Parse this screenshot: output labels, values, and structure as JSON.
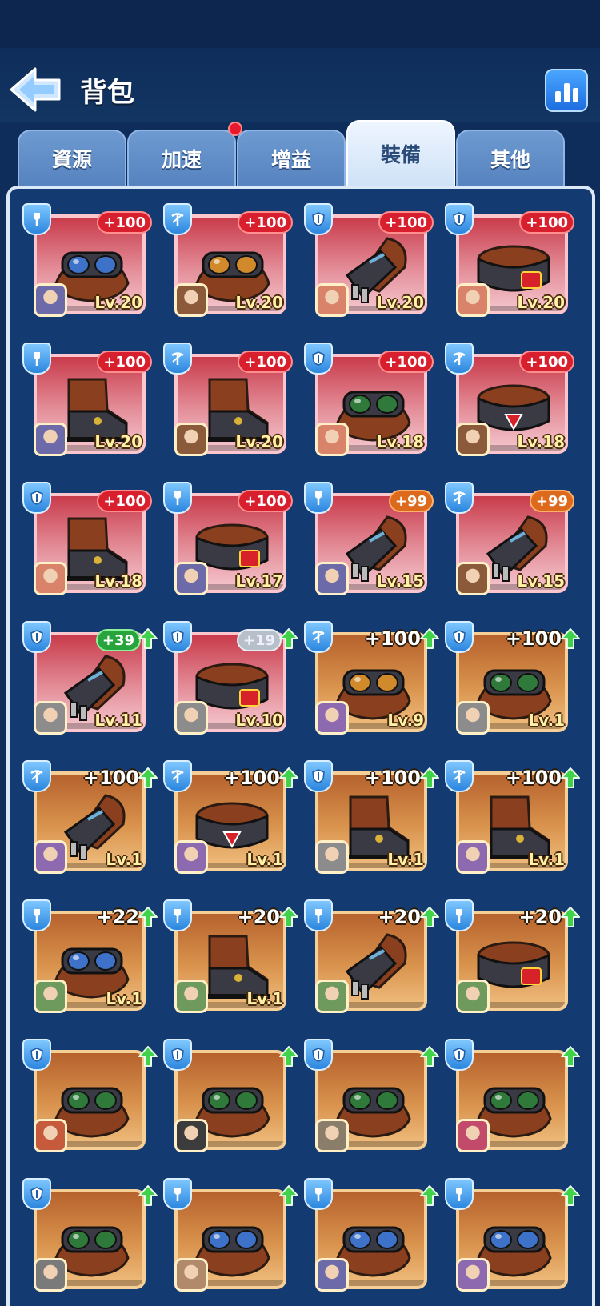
{
  "header": {
    "title": "背包"
  },
  "tabs": [
    {
      "label": "資源",
      "active": false,
      "dot": false
    },
    {
      "label": "加速",
      "active": false,
      "dot": true
    },
    {
      "label": "增益",
      "active": false,
      "dot": false
    },
    {
      "label": "裝備",
      "active": true,
      "dot": false
    },
    {
      "label": "其他",
      "active": false,
      "dot": false
    }
  ],
  "colors": {
    "accent": "#2c86de",
    "red_card": "#c93b4b",
    "orange_card": "#d9934d",
    "badge_red": "#d81f2e",
    "badge_green": "#27a53c"
  },
  "items": [
    {
      "cls": "shovel",
      "gear": "goggles-blue",
      "bonus": "+100",
      "style": "red",
      "arrow": false,
      "level": "Lv.20",
      "hero": "#6c6aa8",
      "bg": "red"
    },
    {
      "cls": "crossbow",
      "gear": "goggles-orange",
      "bonus": "+100",
      "style": "red",
      "arrow": false,
      "level": "Lv.20",
      "hero": "#8a5a3a",
      "bg": "red"
    },
    {
      "cls": "shield",
      "gear": "gauntlet",
      "bonus": "+100",
      "style": "red",
      "arrow": false,
      "level": "Lv.20",
      "hero": "#d9846a",
      "bg": "red"
    },
    {
      "cls": "shield",
      "gear": "bracer-red",
      "bonus": "+100",
      "style": "red",
      "arrow": false,
      "level": "Lv.20",
      "hero": "#d9846a",
      "bg": "red"
    },
    {
      "cls": "shovel",
      "gear": "boot",
      "bonus": "+100",
      "style": "red",
      "arrow": false,
      "level": "Lv.20",
      "hero": "#6c6aa8",
      "bg": "red"
    },
    {
      "cls": "crossbow",
      "gear": "boot",
      "bonus": "+100",
      "style": "red",
      "arrow": false,
      "level": "Lv.20",
      "hero": "#8a5a3a",
      "bg": "red"
    },
    {
      "cls": "shield",
      "gear": "goggles-green",
      "bonus": "+100",
      "style": "red",
      "arrow": false,
      "level": "Lv.18",
      "hero": "#d9846a",
      "bg": "red"
    },
    {
      "cls": "crossbow",
      "gear": "bracer-tri",
      "bonus": "+100",
      "style": "red",
      "arrow": false,
      "level": "Lv.18",
      "hero": "#8a5a3a",
      "bg": "red"
    },
    {
      "cls": "shield",
      "gear": "boot",
      "bonus": "+100",
      "style": "red",
      "arrow": false,
      "level": "Lv.18",
      "hero": "#d9846a",
      "bg": "red"
    },
    {
      "cls": "shovel",
      "gear": "bracer-red",
      "bonus": "+100",
      "style": "red",
      "arrow": false,
      "level": "Lv.17",
      "hero": "#6c6aa8",
      "bg": "red"
    },
    {
      "cls": "shovel",
      "gear": "gauntlet",
      "bonus": "+99",
      "style": "orange",
      "arrow": false,
      "level": "Lv.15",
      "hero": "#6c6aa8",
      "bg": "red"
    },
    {
      "cls": "crossbow",
      "gear": "gauntlet",
      "bonus": "+99",
      "style": "orange",
      "arrow": false,
      "level": "Lv.15",
      "hero": "#8a5a3a",
      "bg": "red"
    },
    {
      "cls": "shield",
      "gear": "gauntlet",
      "bonus": "+39",
      "style": "green",
      "arrow": true,
      "level": "Lv.11",
      "hero": "#8c8c8c",
      "bg": "red"
    },
    {
      "cls": "shield",
      "gear": "bracer-red",
      "bonus": "+19",
      "style": "silver",
      "arrow": true,
      "level": "Lv.10",
      "hero": "#8c8c8c",
      "bg": "red"
    },
    {
      "cls": "crossbow",
      "gear": "goggles-orange",
      "bonus": "+100",
      "style": "plain",
      "arrow": true,
      "level": "Lv.9",
      "hero": "#8d6ab0",
      "bg": "orange"
    },
    {
      "cls": "shield",
      "gear": "goggles-green",
      "bonus": "+100",
      "style": "plain",
      "arrow": true,
      "level": "Lv.1",
      "hero": "#8c8c8c",
      "bg": "orange"
    },
    {
      "cls": "crossbow",
      "gear": "gauntlet",
      "bonus": "+100",
      "style": "plain",
      "arrow": true,
      "level": "Lv.1",
      "hero": "#8d6ab0",
      "bg": "orange"
    },
    {
      "cls": "crossbow",
      "gear": "bracer-tri",
      "bonus": "+100",
      "style": "plain",
      "arrow": true,
      "level": "Lv.1",
      "hero": "#8d6ab0",
      "bg": "orange"
    },
    {
      "cls": "shield",
      "gear": "boot",
      "bonus": "+100",
      "style": "plain",
      "arrow": true,
      "level": "Lv.1",
      "hero": "#8c8c8c",
      "bg": "orange"
    },
    {
      "cls": "crossbow",
      "gear": "boot",
      "bonus": "+100",
      "style": "plain",
      "arrow": true,
      "level": "Lv.1",
      "hero": "#8d6ab0",
      "bg": "orange"
    },
    {
      "cls": "shovel",
      "gear": "goggles-blue",
      "bonus": "+22",
      "style": "plain",
      "arrow": true,
      "level": "Lv.1",
      "hero": "#6e9a5e",
      "bg": "orange"
    },
    {
      "cls": "shovel",
      "gear": "boot",
      "bonus": "+20",
      "style": "plain",
      "arrow": true,
      "level": "Lv.1",
      "hero": "#6e9a5e",
      "bg": "orange"
    },
    {
      "cls": "shovel",
      "gear": "gauntlet",
      "bonus": "+20",
      "style": "plain",
      "arrow": true,
      "level": "",
      "hero": "#6e9a5e",
      "bg": "orange"
    },
    {
      "cls": "shovel",
      "gear": "bracer-red",
      "bonus": "+20",
      "style": "plain",
      "arrow": true,
      "level": "",
      "hero": "#6e9a5e",
      "bg": "orange"
    },
    {
      "cls": "shield",
      "gear": "goggles-green",
      "bonus": "",
      "style": "none",
      "arrow": true,
      "level": "",
      "hero": "#c65a3c",
      "bg": "orange"
    },
    {
      "cls": "shield",
      "gear": "goggles-green",
      "bonus": "",
      "style": "none",
      "arrow": true,
      "level": "",
      "hero": "#3c3c3c",
      "bg": "orange"
    },
    {
      "cls": "shield",
      "gear": "goggles-green",
      "bonus": "",
      "style": "none",
      "arrow": true,
      "level": "",
      "hero": "#8a7e6a",
      "bg": "orange"
    },
    {
      "cls": "shield",
      "gear": "goggles-green",
      "bonus": "",
      "style": "none",
      "arrow": true,
      "level": "",
      "hero": "#c24a6a",
      "bg": "orange"
    },
    {
      "cls": "shield",
      "gear": "goggles-green",
      "bonus": "",
      "style": "none",
      "arrow": true,
      "level": "",
      "hero": "#7a7a7a",
      "bg": "orange"
    },
    {
      "cls": "shovel",
      "gear": "goggles-blue",
      "bonus": "",
      "style": "none",
      "arrow": true,
      "level": "",
      "hero": "#b08a6a",
      "bg": "orange"
    },
    {
      "cls": "shovel",
      "gear": "goggles-blue",
      "bonus": "",
      "style": "none",
      "arrow": true,
      "level": "",
      "hero": "#6c6aa8",
      "bg": "orange"
    },
    {
      "cls": "shovel",
      "gear": "goggles-blue",
      "bonus": "",
      "style": "none",
      "arrow": true,
      "level": "",
      "hero": "#8d6ab0",
      "bg": "orange"
    }
  ]
}
